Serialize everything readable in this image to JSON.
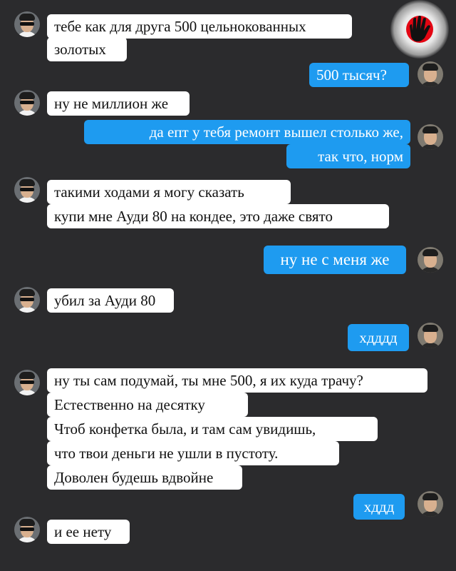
{
  "messages": [
    {
      "side": "in",
      "lines": [
        "тебе как для друга 500 цельнокованных",
        "золотых"
      ]
    },
    {
      "side": "out",
      "lines": [
        "500 тысяч?"
      ]
    },
    {
      "side": "in",
      "lines": [
        "ну не миллион же"
      ]
    },
    {
      "side": "out",
      "lines": [
        "да епт у тебя ремонт вышел столько же,",
        "так что, норм"
      ]
    },
    {
      "side": "in",
      "lines": [
        "такими ходами я могу сказать",
        "купи мне Ауди 80 на кондее, это даже свято"
      ]
    },
    {
      "side": "out",
      "lines": [
        "ну не с меня же"
      ]
    },
    {
      "side": "in",
      "lines": [
        "убил за Ауди 80"
      ]
    },
    {
      "side": "out",
      "lines": [
        "хдддд"
      ]
    },
    {
      "side": "in",
      "lines": [
        "ну ты сам подумай, ты мне 500, я их куда трачу?",
        "Естественно на десятку",
        "Чтоб конфетка была, и там сам увидишь,",
        "что твои деньги не ушли в пустоту.",
        "Доволен будешь вдвойне"
      ]
    },
    {
      "side": "out",
      "lines": [
        "хддд"
      ]
    },
    {
      "side": "in",
      "lines": [
        "и ее нету"
      ]
    }
  ],
  "colors": {
    "background": "#2b2b2d",
    "incoming": "#ffffff",
    "outgoing": "#1e9bf0",
    "logo": "#e30613"
  },
  "icons": {
    "logo": "hand-stop-icon"
  }
}
